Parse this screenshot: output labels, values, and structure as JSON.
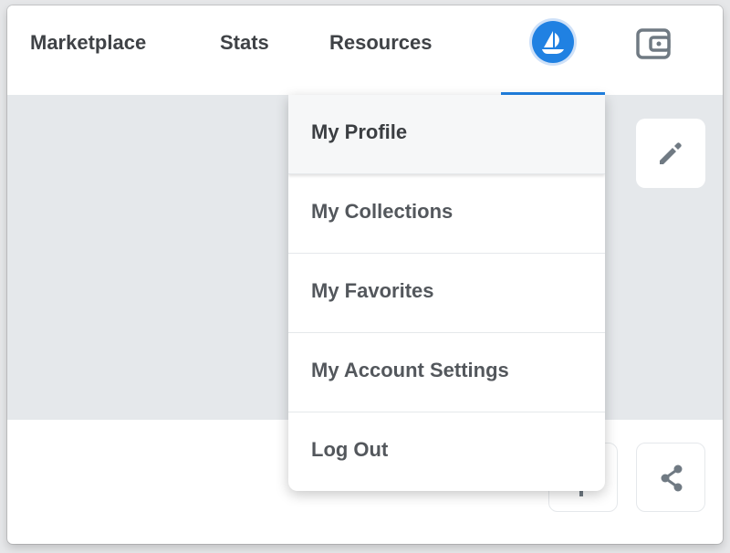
{
  "nav": {
    "marketplace": "Marketplace",
    "stats": "Stats",
    "resources": "Resources",
    "account_icon": "opensea-boat-icon",
    "wallet_icon": "wallet-icon"
  },
  "dropdown": {
    "items": [
      {
        "label": "My Profile",
        "active": true
      },
      {
        "label": "My Collections"
      },
      {
        "label": "My Favorites"
      },
      {
        "label": "My Account Settings"
      },
      {
        "label": "Log Out"
      }
    ]
  },
  "profile_actions": {
    "edit_icon": "pencil-icon",
    "share_icon": "share-icon"
  },
  "colors": {
    "accent": "#2081e2",
    "text": "#3f4246",
    "banner": "#e5e8eb"
  }
}
